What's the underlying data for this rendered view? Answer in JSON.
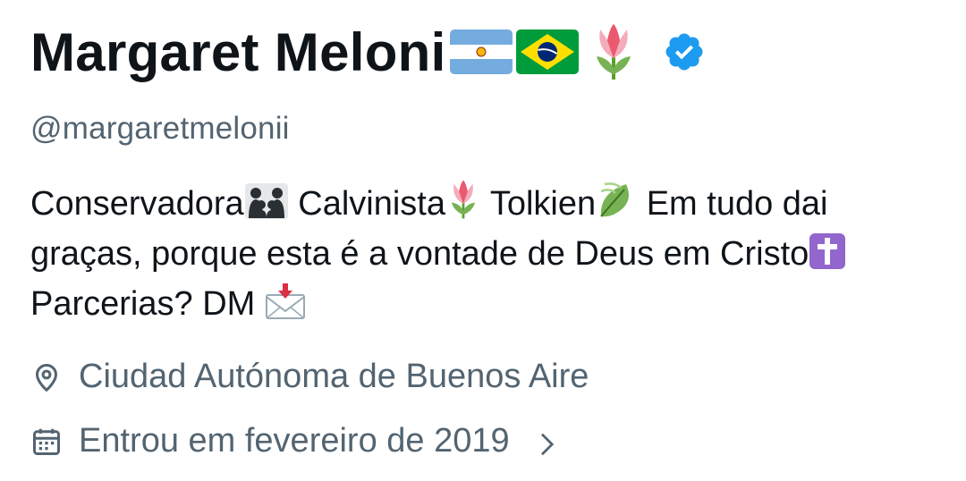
{
  "profile": {
    "display_name": "Margaret Meloni",
    "handle": "@margaretmelonii",
    "flags": [
      "argentina-flag-icon",
      "brazil-flag-icon"
    ],
    "name_emoji": "tulip-icon",
    "verified": true,
    "verified_color": "#1d9bf0"
  },
  "bio": {
    "line1_part1": "Conservadora",
    "line1_part2": " Calvinista",
    "line1_part3": " Tolkien",
    "line1_part4": " Em tudo dai",
    "line2": "graças, porque esta é a vontade de Deus em Cristo",
    "line3": "Parcerias? DM "
  },
  "meta": {
    "location": "Ciudad Autónoma de Buenos Aire",
    "joined": "Entrou em fevereiro de 2019"
  },
  "colors": {
    "text_primary": "#0f1419",
    "text_secondary": "#536471",
    "background": "#ffffff"
  }
}
